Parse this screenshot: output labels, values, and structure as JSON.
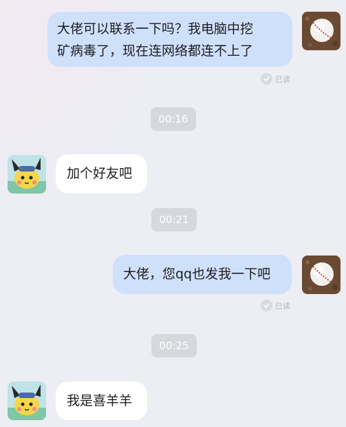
{
  "messages": [
    {
      "side": "out",
      "text_line1": "大佬可以联系一下吗？我电脑中挖",
      "text_line2": "矿病毒了，现在连网络都连不上了",
      "status": "已读",
      "avatar_icon": "baseball-icon"
    },
    {
      "timestamp": "00:16"
    },
    {
      "side": "in",
      "text": "加个好友吧",
      "avatar_icon": "pichu-icon"
    },
    {
      "timestamp": "00:21"
    },
    {
      "side": "out",
      "text": "大佬，您qq也发我一下吧",
      "status": "已读",
      "avatar_icon": "baseball-icon"
    },
    {
      "timestamp": "00:25"
    },
    {
      "side": "in",
      "text": "我是喜羊羊",
      "avatar_icon": "pichu-icon"
    }
  ],
  "colors": {
    "out_bubble": "#cfe0fb",
    "in_bubble": "#ffffff",
    "timestamp_bg": "#d6d8de",
    "background": "#eceef4"
  }
}
